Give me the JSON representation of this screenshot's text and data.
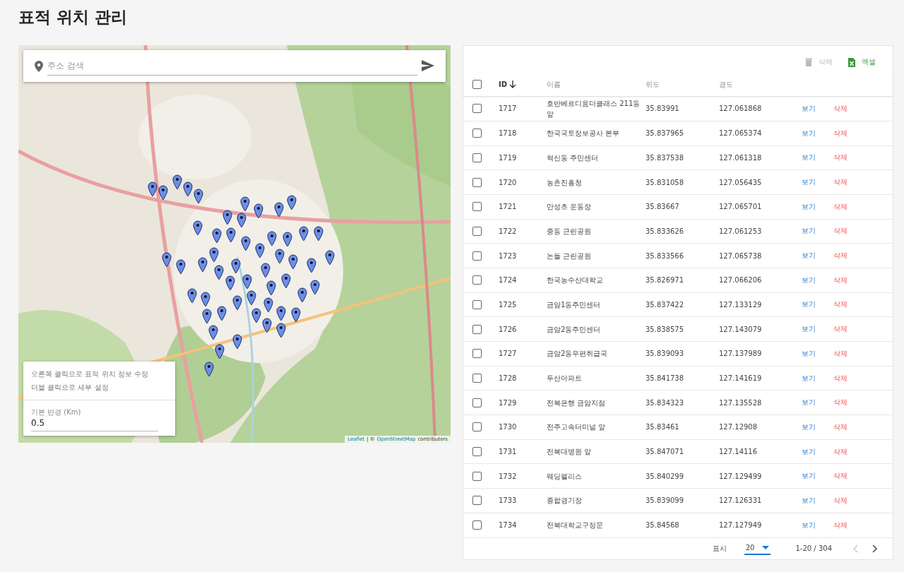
{
  "title": "표적 위치 관리",
  "map": {
    "search": {
      "placeholder": "주소 검색"
    },
    "info": {
      "lines": [
        "오른쪽 클릭으로 표적 위치 정보 수정",
        "더블 클릭으로 세부 설정"
      ],
      "radius_label": "기본 반경 (Km)",
      "radius_value": "0.5"
    },
    "attribution": {
      "leaflet": "Leaflet",
      "separator": "| ©",
      "osm": "OpenStreetMap",
      "suffix": "contributors"
    }
  },
  "toolbar": {
    "delete": {
      "label": "삭제",
      "disabled": true
    },
    "excel": {
      "label": "엑셀",
      "disabled": false
    }
  },
  "table": {
    "select_all": {
      "checked": false
    },
    "columns": [
      {
        "label": "ID",
        "sorted": true
      },
      {
        "label": "이름",
        "sorted": false
      },
      {
        "label": "위도",
        "sorted": false
      },
      {
        "label": "경도",
        "sorted": false
      }
    ],
    "rows": [
      {
        "id": "1717",
        "name": "호반베르디움더클래스 211동 앞",
        "lat": "35.83991",
        "lng": "127.061868",
        "view": "보기",
        "delete": "삭제",
        "checked": false
      },
      {
        "id": "1718",
        "name": "한국국토정보공사 본부",
        "lat": "35.837965",
        "lng": "127.065374",
        "view": "보기",
        "delete": "삭제",
        "checked": false
      },
      {
        "id": "1719",
        "name": "혁신동 주민센터",
        "lat": "35.837538",
        "lng": "127.061318",
        "view": "보기",
        "delete": "삭제",
        "checked": false
      },
      {
        "id": "1720",
        "name": "농촌진흥청",
        "lat": "35.831058",
        "lng": "127.056435",
        "view": "보기",
        "delete": "삭제",
        "checked": false
      },
      {
        "id": "1721",
        "name": "만성초 운동장",
        "lat": "35.83667",
        "lng": "127.065701",
        "view": "보기",
        "delete": "삭제",
        "checked": false
      },
      {
        "id": "1722",
        "name": "중동 근린공원",
        "lat": "35.833626",
        "lng": "127.061253",
        "view": "보기",
        "delete": "삭제",
        "checked": false
      },
      {
        "id": "1723",
        "name": "논들 근린공원",
        "lat": "35.833566",
        "lng": "127.065738",
        "view": "보기",
        "delete": "삭제",
        "checked": false
      },
      {
        "id": "1724",
        "name": "한국농수산대학교",
        "lat": "35.826971",
        "lng": "127.066206",
        "view": "보기",
        "delete": "삭제",
        "checked": false
      },
      {
        "id": "1725",
        "name": "금암1동주민센터",
        "lat": "35.837422",
        "lng": "127.133129",
        "view": "보기",
        "delete": "삭제",
        "checked": false
      },
      {
        "id": "1726",
        "name": "금암2동주민센터",
        "lat": "35.838575",
        "lng": "127.143079",
        "view": "보기",
        "delete": "삭제",
        "checked": false
      },
      {
        "id": "1727",
        "name": "금암2동우편취급국",
        "lat": "35.839093",
        "lng": "127.137989",
        "view": "보기",
        "delete": "삭제",
        "checked": false
      },
      {
        "id": "1728",
        "name": "두산아파트",
        "lat": "35.841738",
        "lng": "127.141619",
        "view": "보기",
        "delete": "삭제",
        "checked": false
      },
      {
        "id": "1729",
        "name": "전북은행 금암지점",
        "lat": "35.834323",
        "lng": "127.135528",
        "view": "보기",
        "delete": "삭제",
        "checked": false
      },
      {
        "id": "1730",
        "name": "전주고속터미널 앞",
        "lat": "35.83461",
        "lng": "127.12908",
        "view": "보기",
        "delete": "삭제",
        "checked": false
      },
      {
        "id": "1731",
        "name": "전북대병원 앞",
        "lat": "35.847071",
        "lng": "127.14116",
        "view": "보기",
        "delete": "삭제",
        "checked": false
      },
      {
        "id": "1732",
        "name": "웨딩펠리스",
        "lat": "35.840299",
        "lng": "127.129499",
        "view": "보기",
        "delete": "삭제",
        "checked": false
      },
      {
        "id": "1733",
        "name": "종합경기장",
        "lat": "35.839099",
        "lng": "127.126331",
        "view": "보기",
        "delete": "삭제",
        "checked": false
      },
      {
        "id": "1734",
        "name": "전북대학교구정문",
        "lat": "35.84568",
        "lng": "127.127949",
        "view": "보기",
        "delete": "삭제",
        "checked": false
      }
    ]
  },
  "pagination": {
    "rows_label": "표시",
    "rows_value": "20",
    "range": "1-20 / 304",
    "prev_disabled": true,
    "next_disabled": false
  }
}
